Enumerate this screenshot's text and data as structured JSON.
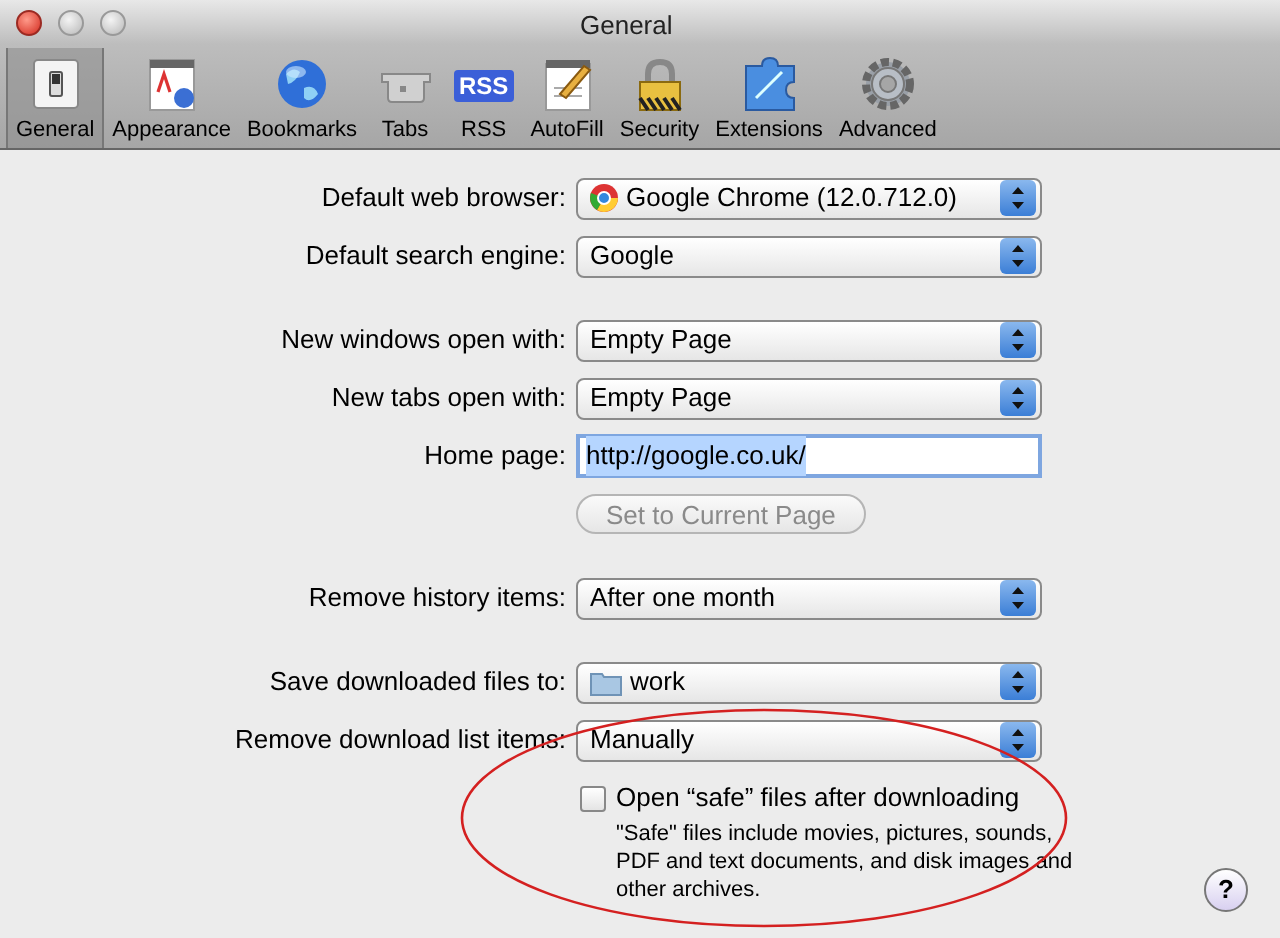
{
  "window": {
    "title": "General"
  },
  "toolbar": [
    {
      "label": "General",
      "kind": "switch",
      "selected": true
    },
    {
      "label": "Appearance",
      "kind": "appearance",
      "selected": false
    },
    {
      "label": "Bookmarks",
      "kind": "globe",
      "selected": false
    },
    {
      "label": "Tabs",
      "kind": "tabs",
      "selected": false
    },
    {
      "label": "RSS",
      "kind": "rss",
      "badge": "RSS",
      "selected": false
    },
    {
      "label": "AutoFill",
      "kind": "autofill",
      "selected": false
    },
    {
      "label": "Security",
      "kind": "lock",
      "selected": false
    },
    {
      "label": "Extensions",
      "kind": "puzzle",
      "selected": false
    },
    {
      "label": "Advanced",
      "kind": "gear",
      "selected": false
    }
  ],
  "sections": [
    {
      "rows": [
        {
          "kind": "browser",
          "label": "Default web browser:",
          "value": "Google Chrome (12.0.712.0)"
        },
        {
          "kind": "popup",
          "label": "Default search engine:",
          "value": "Google"
        }
      ]
    },
    {
      "rows": [
        {
          "kind": "popup",
          "label": "New windows open with:",
          "value": "Empty Page"
        },
        {
          "kind": "popup",
          "label": "New tabs open with:",
          "value": "Empty Page"
        },
        {
          "kind": "field",
          "label": "Home page:",
          "value": "http://google.co.uk/"
        },
        {
          "kind": "button",
          "value": "Set to Current Page",
          "disabled": true
        }
      ]
    },
    {
      "rows": [
        {
          "kind": "popup",
          "label": "Remove history items:",
          "value": "After one month"
        }
      ]
    },
    {
      "rows": [
        {
          "kind": "folder",
          "label": "Save downloaded files to:",
          "value": "work"
        },
        {
          "kind": "popup",
          "label": "Remove download list items:",
          "value": "Manually"
        },
        {
          "kind": "checkbox",
          "value": "Open “safe” files after downloading",
          "checked": false,
          "note": "\"Safe\" files include movies, pictures, sounds, PDF and text documents, and disk images and other archives."
        }
      ]
    }
  ],
  "help": {
    "label": "?"
  }
}
